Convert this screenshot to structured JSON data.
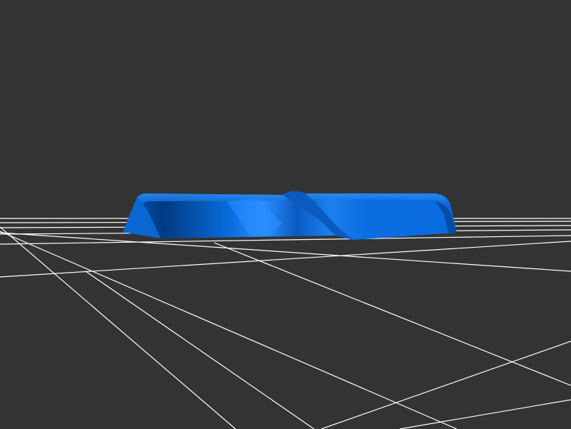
{
  "scene": {
    "background_color": "#333333",
    "grid_color": "#ffffff",
    "model": {
      "name": "blue-twisted-bar-model",
      "base_color": "#0a6fe0",
      "highlight_color": "#2a8fff",
      "shadow_color": "#003a80"
    }
  }
}
